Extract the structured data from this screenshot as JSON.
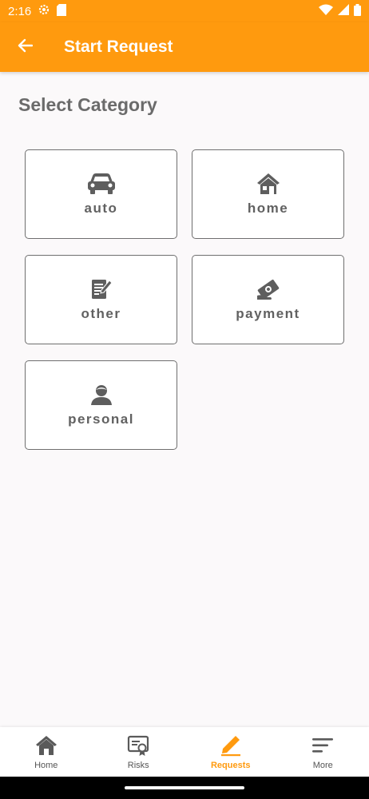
{
  "status_bar": {
    "time": "2:16"
  },
  "app_bar": {
    "title": "Start Request"
  },
  "section": {
    "title": "Select Category"
  },
  "categories": [
    {
      "label": "auto",
      "icon": "car-icon"
    },
    {
      "label": "home",
      "icon": "house-icon"
    },
    {
      "label": "other",
      "icon": "document-edit-icon"
    },
    {
      "label": "payment",
      "icon": "payment-icon"
    },
    {
      "label": "personal",
      "icon": "person-icon"
    }
  ],
  "bottom_nav": {
    "items": [
      {
        "label": "Home",
        "icon": "home-icon"
      },
      {
        "label": "Risks",
        "icon": "certificate-icon"
      },
      {
        "label": "Requests",
        "icon": "pencil-icon",
        "active": true
      },
      {
        "label": "More",
        "icon": "menu-icon"
      }
    ]
  },
  "colors": {
    "accent": "#ff9a0e",
    "background": "#fbf9fa",
    "text": "#616161"
  }
}
